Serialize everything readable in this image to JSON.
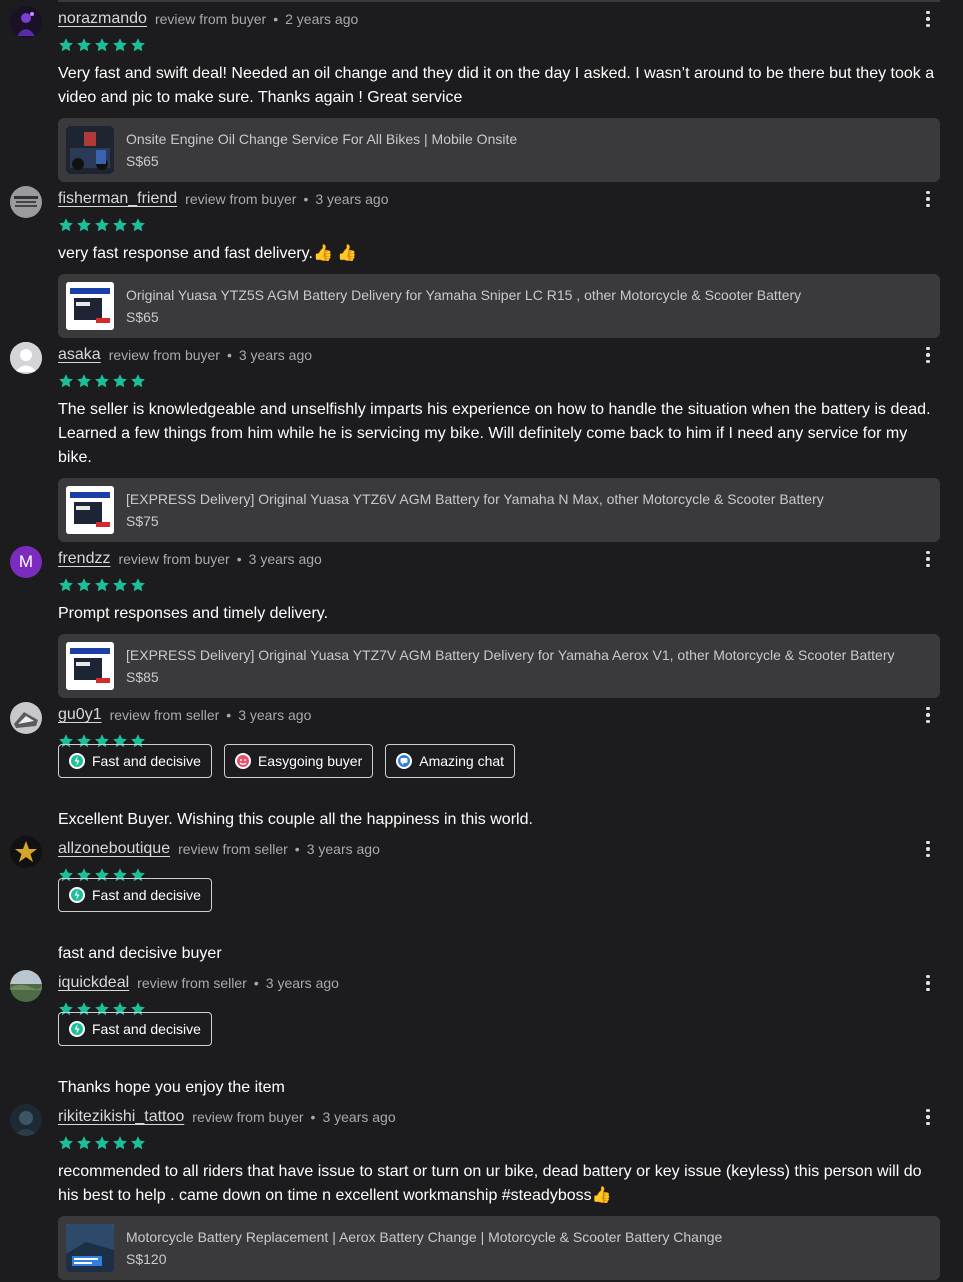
{
  "reviews": [
    {
      "username": "norazmando",
      "type": "review from buyer",
      "ago": "2 years ago",
      "avatar_icon": "purple-figure-icon",
      "text": "Very fast and swift deal! Needed an oil change and they did it on the day I asked. I wasn’t around to be there but they took a video and pic to make sure. Thanks again ! Great service",
      "product": {
        "title": "Onsite Engine Oil Change Service For All Bikes | Mobile Onsite",
        "price": "S$65"
      }
    },
    {
      "username": "fisherman_friend",
      "type": "review from buyer",
      "ago": "3 years ago",
      "avatar_icon": "grey-text-logo-icon",
      "text": "very fast response and fast delivery.👍 👍",
      "product": {
        "title": "Original Yuasa YTZ5S AGM Battery Delivery for Yamaha Sniper LC R15 , other Motorcycle & Scooter Battery",
        "price": "S$65"
      }
    },
    {
      "username": "asaka",
      "type": "review from buyer",
      "ago": "3 years ago",
      "avatar_icon": "default-user-icon",
      "text": "The seller is knowledgeable and unselfishly imparts his experience on how to handle the situation when the battery is dead. Learned a few things from him while he is servicing my bike. Will definitely come back to him if I need any service for my bike.",
      "product": {
        "title": "[EXPRESS Delivery] Original Yuasa YTZ6V AGM Battery for Yamaha N Max, other Motorcycle & Scooter Battery",
        "price": "S$75"
      }
    },
    {
      "username": "frendzz",
      "type": "review from buyer",
      "ago": "3 years ago",
      "avatar_letter": "M",
      "text": "Prompt responses and timely delivery.",
      "product": {
        "title": "[EXPRESS Delivery] Original Yuasa YTZ7V AGM Battery Delivery for Yamaha Aerox V1, other Motorcycle & Scooter Battery",
        "price": "S$85"
      }
    },
    {
      "username": "gu0y1",
      "type": "review from seller",
      "ago": "3 years ago",
      "avatar_icon": "sneaker-photo-icon",
      "tags": [
        "Fast and decisive",
        "Easygoing buyer",
        "Amazing chat"
      ],
      "text": "Excellent Buyer. Wishing this couple all the happiness in this world."
    },
    {
      "username": "allzoneboutique",
      "type": "review from seller",
      "ago": "3 years ago",
      "avatar_icon": "gold-star-logo-icon",
      "tags": [
        "Fast and decisive"
      ],
      "text": "fast and decisive buyer"
    },
    {
      "username": "iquickdeal",
      "type": "review from seller",
      "ago": "3 years ago",
      "avatar_icon": "landscape-photo-icon",
      "tags": [
        "Fast and decisive"
      ],
      "text": "Thanks hope you enjoy the item"
    },
    {
      "username": "rikitezikishi_tattoo",
      "type": "review from buyer",
      "ago": "3 years ago",
      "avatar_icon": "dark-photo-icon",
      "text": "recommended to all riders that have issue to start or turn on ur bike, dead battery or key issue (keyless) this person will do his best to help . came down on time n excellent workmanship #steadyboss👍",
      "product": {
        "title": "Motorcycle Battery Replacement | Aerox Battery Change | Motorcycle & Scooter Battery Change",
        "price": "S$120"
      }
    }
  ],
  "rating_stars": 5,
  "colors": {
    "star": "#1dbf9b",
    "background": "#1c1c1e",
    "card": "#3a3a3c",
    "avatar_letter_bg": "#7b2cbf"
  }
}
